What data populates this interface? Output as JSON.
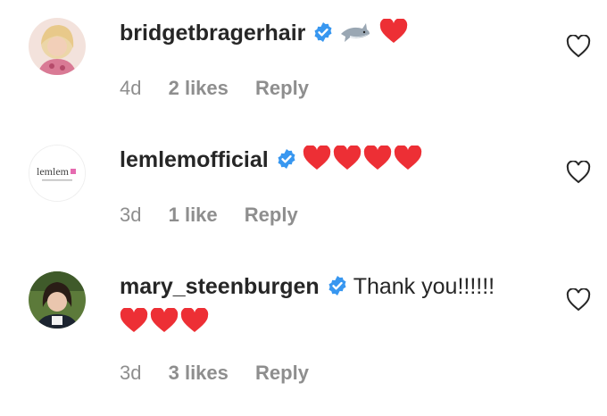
{
  "comments": [
    {
      "username": "bridgetbragerhair",
      "verified": true,
      "text": "",
      "emoji": [
        "shark-emoji",
        "red-heart-emoji"
      ],
      "age": "4d",
      "likes": "2 likes",
      "reply": "Reply"
    },
    {
      "username": "lemlemofficial",
      "verified": true,
      "text": "",
      "emoji": [
        "red-heart-emoji",
        "red-heart-emoji",
        "red-heart-emoji",
        "red-heart-emoji"
      ],
      "age": "3d",
      "likes": "1 like",
      "reply": "Reply",
      "avatar_logo_text": "lemlem"
    },
    {
      "username": "mary_steenburgen",
      "verified": true,
      "text": "Thank you!!!!!!",
      "emoji": [
        "red-heart-emoji",
        "red-heart-emoji",
        "red-heart-emoji"
      ],
      "age": "3d",
      "likes": "3 likes",
      "reply": "Reply"
    }
  ],
  "colors": {
    "verified_blue": "#3897f0",
    "heart_red": "#ed2f35",
    "meta_gray": "#8e8e8e",
    "text": "#262626"
  }
}
